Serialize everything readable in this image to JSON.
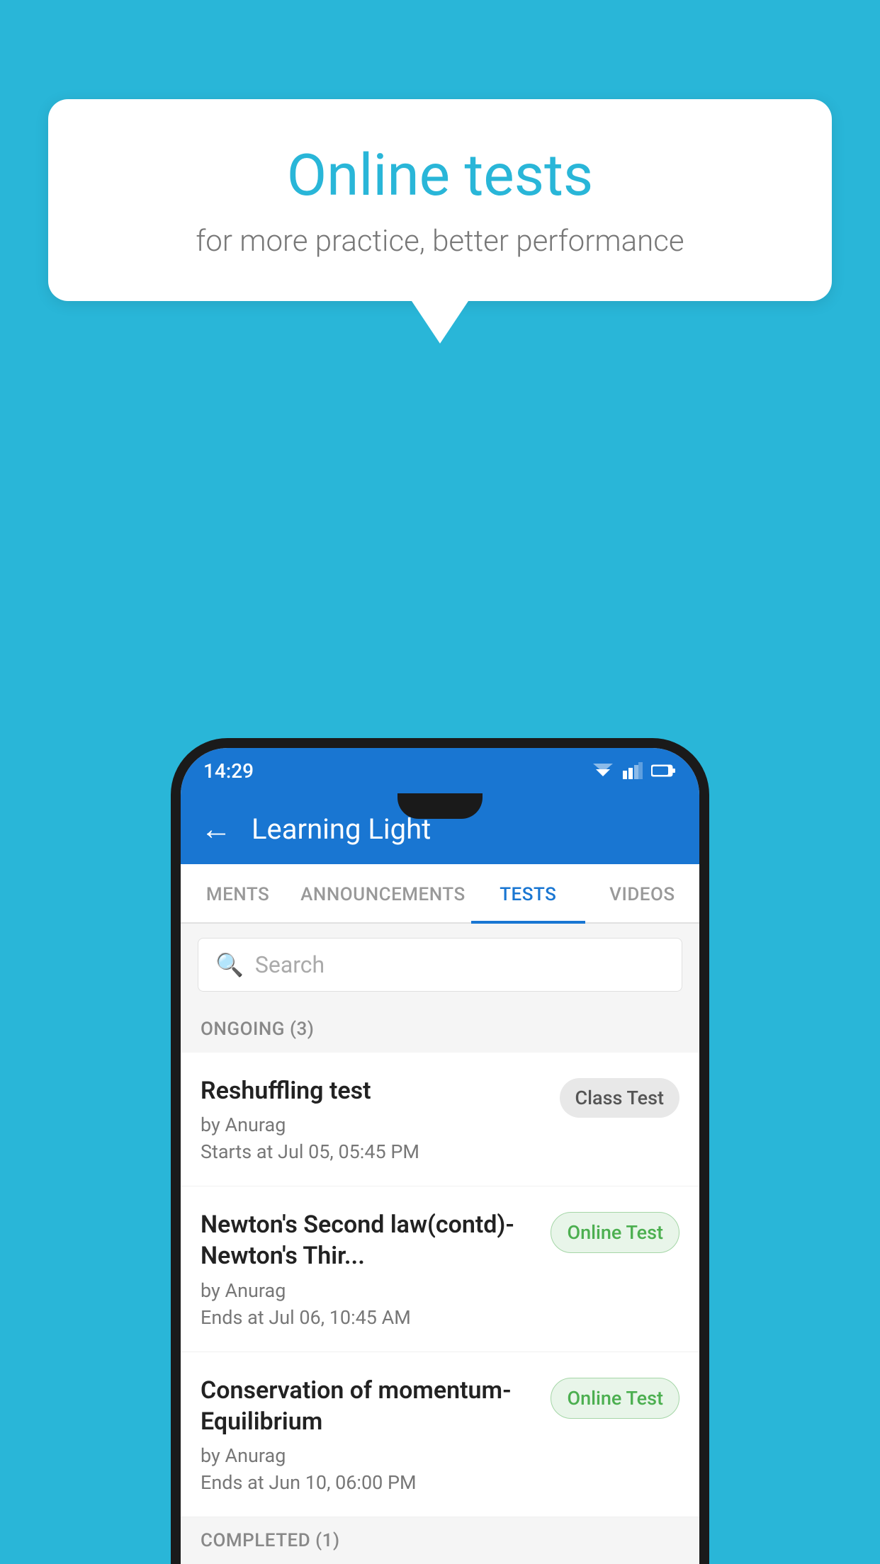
{
  "background_color": "#29b6d8",
  "speech_bubble": {
    "title": "Online tests",
    "subtitle": "for more practice, better performance"
  },
  "status_bar": {
    "time": "14:29"
  },
  "app_header": {
    "title": "Learning Light",
    "back_label": "←"
  },
  "tabs": [
    {
      "label": "MENTS",
      "active": false
    },
    {
      "label": "ANNOUNCEMENTS",
      "active": false
    },
    {
      "label": "TESTS",
      "active": true
    },
    {
      "label": "VIDEOS",
      "active": false
    }
  ],
  "search": {
    "placeholder": "Search"
  },
  "ongoing_section": {
    "label": "ONGOING (3)"
  },
  "tests": [
    {
      "title": "Reshuffling test",
      "author": "by Anurag",
      "time": "Starts at  Jul 05, 05:45 PM",
      "badge": "Class Test",
      "badge_type": "class"
    },
    {
      "title": "Newton's Second law(contd)-Newton's Thir...",
      "author": "by Anurag",
      "time": "Ends at  Jul 06, 10:45 AM",
      "badge": "Online Test",
      "badge_type": "online"
    },
    {
      "title": "Conservation of momentum-Equilibrium",
      "author": "by Anurag",
      "time": "Ends at  Jun 10, 06:00 PM",
      "badge": "Online Test",
      "badge_type": "online"
    }
  ],
  "completed_section": {
    "label": "COMPLETED (1)"
  }
}
